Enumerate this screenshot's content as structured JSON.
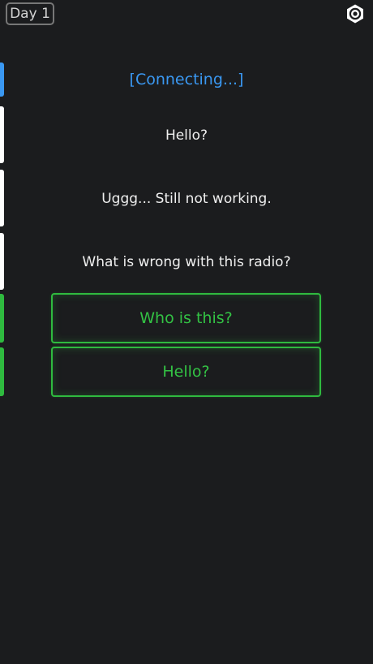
{
  "header": {
    "day_label": "Day 1"
  },
  "icons": {
    "settings": "gear-icon"
  },
  "colors": {
    "background": "#1b1c1e",
    "system_text": "#3a98f2",
    "choice_green": "#33c244",
    "message_text": "#efefef"
  },
  "conversation": {
    "system_message": "[Connecting...]",
    "messages": [
      "Hello?",
      "Uggg... Still not working.",
      "What is wrong with this radio?"
    ]
  },
  "choices": [
    "Who is this?",
    "Hello?"
  ],
  "history_markers": [
    {
      "kind": "system",
      "color": "#3a98f2"
    },
    {
      "kind": "message",
      "color": "#ffffff"
    },
    {
      "kind": "message",
      "color": "#ffffff"
    },
    {
      "kind": "message",
      "color": "#ffffff"
    },
    {
      "kind": "choice",
      "color": "#2fba3f"
    },
    {
      "kind": "choice",
      "color": "#2fba3f"
    }
  ]
}
